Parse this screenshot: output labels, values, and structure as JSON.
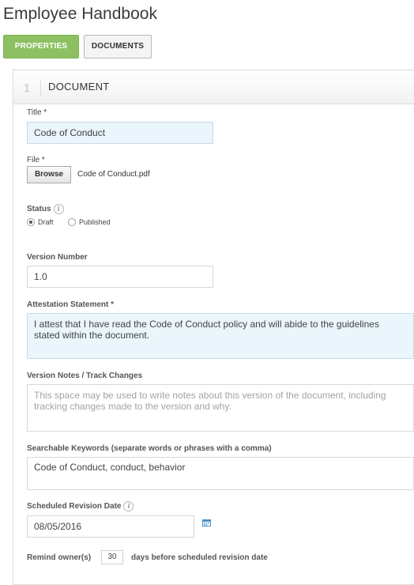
{
  "page": {
    "title": "Employee Handbook"
  },
  "tabs": [
    {
      "label": "PROPERTIES",
      "active": true
    },
    {
      "label": "DOCUMENTS",
      "active": false
    }
  ],
  "section": {
    "number": "1",
    "title": "DOCUMENT"
  },
  "form": {
    "title": {
      "label": "Title *",
      "value": "Code of Conduct"
    },
    "file": {
      "label": "File *",
      "button": "Browse",
      "filename": "Code of Conduct.pdf"
    },
    "status": {
      "label": "Status",
      "options": [
        {
          "label": "Draft",
          "checked": true
        },
        {
          "label": "Published",
          "checked": false
        }
      ]
    },
    "version_number": {
      "label": "Version Number",
      "value": "1.0"
    },
    "attestation": {
      "label": "Attestation Statement *",
      "value": "I attest that I have read the Code of Conduct policy and will abide to the guidelines stated within the document."
    },
    "version_notes": {
      "label": "Version Notes / Track Changes",
      "placeholder": "This space may be used to write notes about this version of the document, including tracking changes made to the version and why."
    },
    "keywords": {
      "label": "Searchable Keywords (separate words or phrases with a comma)",
      "value": "Code of Conduct, conduct, behavior"
    },
    "revision_date": {
      "label": "Scheduled Revision Date",
      "value": "08/05/2016"
    },
    "remind": {
      "prefix": "Remind owner(s)",
      "days": "30",
      "suffix": "days before scheduled revision date"
    }
  },
  "colors": {
    "accent_green": "#8cc063",
    "field_blue": "#eaf5fc",
    "calendar_blue": "#4a90c8"
  },
  "icons": [
    "info-icon",
    "calendar-icon"
  ]
}
